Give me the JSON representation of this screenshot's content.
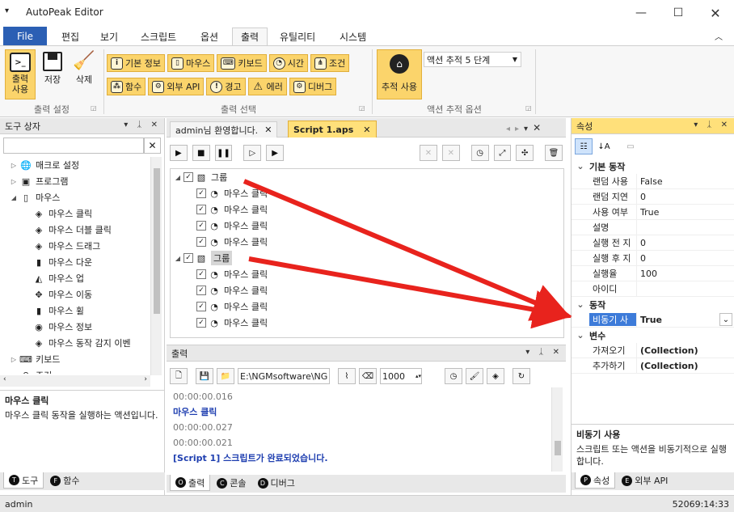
{
  "app": {
    "title": "AutoPeak Editor"
  },
  "ribbon_tabs": [
    "File",
    "편집",
    "보기",
    "스크립트",
    "옵션",
    "출력",
    "유틸리티",
    "시스템"
  ],
  "ribbon": {
    "output_use": "출력\n사용",
    "save": "저장",
    "delete": "삭제",
    "group_output_settings": "출력 설정",
    "chips_row1": [
      "기본 정보",
      "마우스",
      "키보드",
      "시간",
      "조건"
    ],
    "chips_row2": [
      "함수",
      "외부 API",
      "경고",
      "에러",
      "디버그"
    ],
    "group_output_select": "출력 선택",
    "trace_use": "추적 사용",
    "trace_level": "액션 추적 5 단계",
    "group_action_trace": "액션 추적 옵션"
  },
  "toolbox": {
    "title": "도구 상자",
    "items": [
      {
        "label": "매크로 설정",
        "level": 0,
        "expander": "▷"
      },
      {
        "label": "프로그램",
        "level": 0,
        "expander": "▷"
      },
      {
        "label": "마우스",
        "level": 0,
        "expander": "◢"
      },
      {
        "label": "마우스 클릭",
        "level": 1
      },
      {
        "label": "마우스 더블 클릭",
        "level": 1
      },
      {
        "label": "마우스 드래그",
        "level": 1
      },
      {
        "label": "마우스 다운",
        "level": 1
      },
      {
        "label": "마우스 업",
        "level": 1
      },
      {
        "label": "마우스 이동",
        "level": 1
      },
      {
        "label": "마우스 휠",
        "level": 1
      },
      {
        "label": "마우스 정보",
        "level": 1
      },
      {
        "label": "마우스 동작 감지 이벤",
        "level": 1
      },
      {
        "label": "키보드",
        "level": 0,
        "expander": "▷"
      },
      {
        "label": "조건",
        "level": 0,
        "expander": "▷"
      }
    ],
    "desc_title": "마우스 클릭",
    "desc_text": "마우스 클릭 동작을 실행하는 액션입니다.",
    "bottom_tabs": [
      {
        "icon": "T",
        "label": "도구"
      },
      {
        "icon": "F",
        "label": "함수"
      }
    ]
  },
  "editor": {
    "tabs": [
      {
        "label": "admin님 환영합니다."
      },
      {
        "label": "Script 1.aps"
      }
    ],
    "tree": [
      {
        "label": "그룹",
        "type": "group",
        "selected": false
      },
      {
        "label": "마우스 클릭",
        "type": "item"
      },
      {
        "label": "마우스 클릭",
        "type": "item"
      },
      {
        "label": "마우스 클릭",
        "type": "item"
      },
      {
        "label": "마우스 클릭",
        "type": "item"
      },
      {
        "label": "그룹",
        "type": "group",
        "selected": true
      },
      {
        "label": "마우스 클릭",
        "type": "item"
      },
      {
        "label": "마우스 클릭",
        "type": "item"
      },
      {
        "label": "마우스 클릭",
        "type": "item"
      },
      {
        "label": "마우스 클릭",
        "type": "item"
      }
    ]
  },
  "output": {
    "title": "출력",
    "path": "E:\\NGMsoftware\\NG",
    "count": "1000",
    "lines": [
      {
        "text": "00:00:00.016",
        "color": "#777777",
        "bold": false
      },
      {
        "text": "마우스 클릭",
        "color": "#1f3fb0",
        "bold": true
      },
      {
        "text": "00:00:00.027",
        "color": "#777777",
        "bold": false
      },
      {
        "text": "00:00:00.021",
        "color": "#777777",
        "bold": false
      },
      {
        "text": "[Script 1] 스크립트가 완료되었습니다.",
        "color": "#1f3fb0",
        "bold": true
      }
    ],
    "bottom_tabs": [
      {
        "icon": "O",
        "label": "출력"
      },
      {
        "icon": "C",
        "label": "콘솔"
      },
      {
        "icon": "D",
        "label": "디버그"
      }
    ]
  },
  "properties": {
    "title": "속성",
    "sections": [
      {
        "name": "기본 동작",
        "rows": [
          {
            "key": "랜덤 사용",
            "value": "False"
          },
          {
            "key": "랜덤 지연",
            "value": "0"
          },
          {
            "key": "사용 여부",
            "value": "True"
          },
          {
            "key": "설명",
            "value": ""
          },
          {
            "key": "실행 전 지",
            "value": "0"
          },
          {
            "key": "실행 후 지",
            "value": "0"
          },
          {
            "key": "실행율",
            "value": "100"
          },
          {
            "key": "아이디",
            "value": ""
          }
        ]
      },
      {
        "name": "동작",
        "rows": [
          {
            "key": "비동기 사",
            "value": "True",
            "selected": true
          }
        ]
      },
      {
        "name": "변수",
        "rows": [
          {
            "key": "가져오기",
            "value": "(Collection)",
            "bold": true
          },
          {
            "key": "추가하기",
            "value": "(Collection)",
            "bold": true
          }
        ]
      }
    ],
    "desc_title": "비동기 사용",
    "desc_text": "스크립트 또는 액션을 비동기적으로 실행합니다.",
    "bottom_tabs": [
      {
        "icon": "P",
        "label": "속성"
      },
      {
        "icon": "E",
        "label": "외부 API"
      }
    ]
  },
  "statusbar": {
    "user": "admin",
    "time": "52069:14:33"
  },
  "colors": {
    "accent": "#2b5fb4",
    "highlight": "#fbd46b",
    "arrow": "#e8231d"
  }
}
